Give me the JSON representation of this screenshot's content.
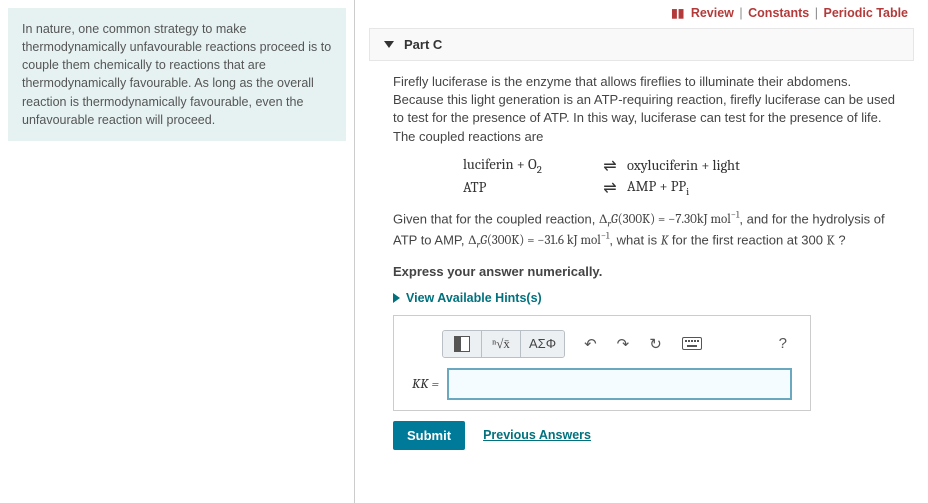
{
  "topLinks": {
    "review": "Review",
    "constants": "Constants",
    "periodic": "Periodic Table"
  },
  "intro": "In nature, one common strategy to make thermodynamically unfavourable reactions proceed is to couple them chemically to reactions that are thermodynamically favourable. As long as the overall reaction is thermodynamically favourable, even the unfavourable reaction will proceed.",
  "part": {
    "label": "Part C",
    "bodyText": "Firefly luciferase is the enzyme that allows fireflies to illuminate their abdomens. Because this light generation is an ATP-requiring reaction, firefly luciferase can be used to test for the presence of ATP. In this way, luciferase can test for the presence of life. The coupled reactions are",
    "eqn1_lhs": "luciferin + O",
    "eqn1_lhs_sub": "2",
    "eqn1_rhs": "oxyluciferin + light",
    "eqn2_lhs": "ATP",
    "eqn2_rhs_a": "AMP + PP",
    "eqn2_rhs_sub": "i",
    "given_pre": "Given that for the coupled reaction, ",
    "delta1": "Δ",
    "sub_r": "r",
    "G": "G",
    "parenK": "(300K) = −7.30kJ mol",
    "neg1": "−1",
    "mid": ", and for the hydrolysis of ATP to AMP, ",
    "parenK2": "(300K) = −31.6 kJ mol",
    "tail1": ", what is ",
    "Kvar": "K",
    "tail2": " for the first reaction at 300 ",
    "Kunit": "K",
    "tail3": " ?",
    "express": "Express your answer numerically.",
    "hints": "View Available Hints(s)",
    "kk_label": "KK =",
    "submit": "Submit",
    "prev": "Previous Answers",
    "tool_greek": "ΑΣΦ",
    "tool_help": "?"
  }
}
